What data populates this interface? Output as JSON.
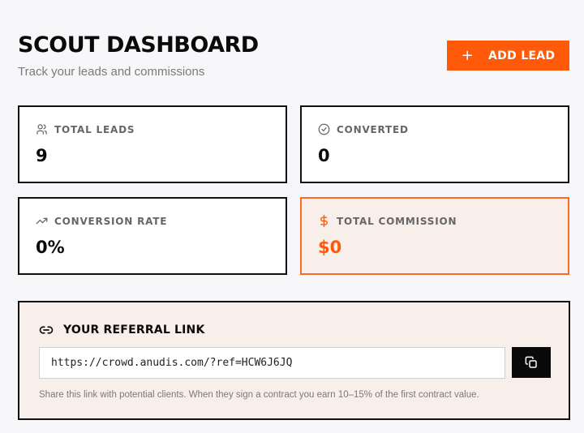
{
  "header": {
    "title": "SCOUT DASHBOARD",
    "subtitle": "Track your leads and commissions",
    "add_button_icon": "plus-icon",
    "add_button_label": "ADD LEAD"
  },
  "stats": [
    {
      "icon": "users-icon",
      "label": "TOTAL LEADS",
      "value": "9"
    },
    {
      "icon": "check-circle-icon",
      "label": "CONVERTED",
      "value": "0"
    },
    {
      "icon": "trending-up-icon",
      "label": "CONVERSION RATE",
      "value": "0%"
    },
    {
      "icon": "dollar-icon",
      "label": "TOTAL COMMISSION",
      "value": "$0"
    }
  ],
  "referral": {
    "icon": "link-icon",
    "title": "YOUR REFERRAL LINK",
    "url": "https://crowd.anudis.com/?ref=HCW6J6JQ",
    "copy_icon": "copy-icon",
    "note": "Share this link with potential clients. When they sign a contract you earn 10–15% of the first contract value."
  },
  "colors": {
    "accent": "#ff5a0a",
    "background": "#f7f7f9",
    "highlight_card_bg": "#f8eeea",
    "border": "#111111"
  }
}
